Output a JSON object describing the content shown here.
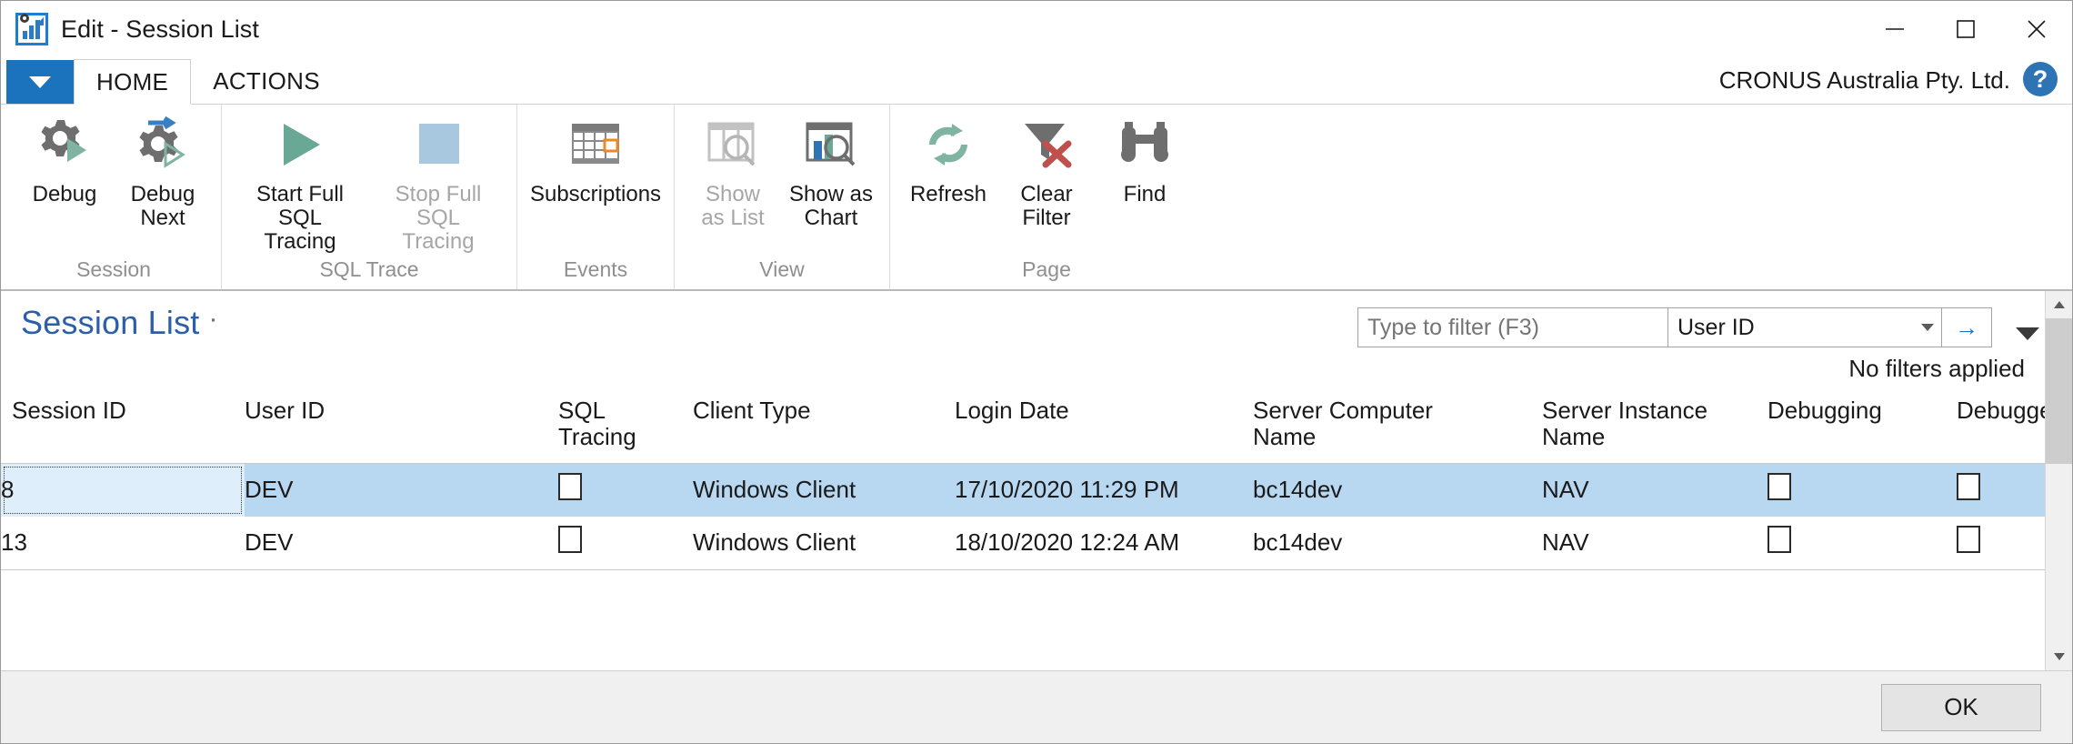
{
  "window": {
    "title": "Edit - Session List",
    "app_icon": "chart-gear-icon",
    "controls": {
      "minimize": "minimize-icon",
      "maximize": "maximize-icon",
      "close": "close-icon"
    }
  },
  "ribbon": {
    "app_menu": "dropdown-caret",
    "tabs": [
      {
        "label": "HOME",
        "active": true
      },
      {
        "label": "ACTIONS",
        "active": false
      }
    ],
    "company": "CRONUS Australia Pty. Ltd.",
    "help": "?",
    "groups": [
      {
        "label": "Session",
        "buttons": [
          {
            "label": "Debug",
            "icon": "gear-play-icon",
            "disabled": false
          },
          {
            "label": "Debug\nNext",
            "line1": "Debug",
            "line2": "Next",
            "icon": "gear-arrow-play-icon",
            "disabled": false
          }
        ]
      },
      {
        "label": "SQL Trace",
        "buttons": [
          {
            "label": "Start Full SQL Tracing",
            "line1": "Start Full SQL",
            "line2": "Tracing",
            "icon": "play-triangle-icon",
            "disabled": false
          },
          {
            "label": "Stop Full SQL Tracing",
            "line1": "Stop Full SQL",
            "line2": "Tracing",
            "icon": "stop-square-icon",
            "disabled": true
          }
        ]
      },
      {
        "label": "Events",
        "buttons": [
          {
            "label": "Subscriptions",
            "line1": "Subscriptions",
            "line2": "",
            "icon": "grid-table-icon",
            "disabled": false
          }
        ]
      },
      {
        "label": "View",
        "buttons": [
          {
            "label": "Show as List",
            "line1": "Show",
            "line2": "as List",
            "icon": "list-search-icon",
            "disabled": true
          },
          {
            "label": "Show as Chart",
            "line1": "Show as",
            "line2": "Chart",
            "icon": "chart-search-icon",
            "disabled": false
          }
        ]
      },
      {
        "label": "Page",
        "buttons": [
          {
            "label": "Refresh",
            "line1": "Refresh",
            "line2": "",
            "icon": "refresh-icon",
            "disabled": false
          },
          {
            "label": "Clear Filter",
            "line1": "Clear",
            "line2": "Filter",
            "icon": "filter-clear-icon",
            "disabled": false
          },
          {
            "label": "Find",
            "line1": "Find",
            "line2": "",
            "icon": "binoculars-icon",
            "disabled": false
          }
        ]
      }
    ]
  },
  "page": {
    "title": "Session List",
    "title_suffix": "·",
    "filter": {
      "placeholder": "Type to filter (F3)",
      "value": "",
      "field": "User ID",
      "go_icon": "arrow-right-icon",
      "dropdown_icon": "chevron-down-icon"
    },
    "collapse_icon": "chevron-down-icon",
    "no_filters_text": "No filters applied"
  },
  "grid": {
    "columns": [
      {
        "key": "session_id",
        "label": "Session ID",
        "line1": "Session ID",
        "line2": "",
        "align": "left"
      },
      {
        "key": "user_id",
        "label": "User ID",
        "line1": "User ID",
        "line2": "",
        "align": "left"
      },
      {
        "key": "sql_tracing",
        "label": "SQL Tracing",
        "line1": "SQL",
        "line2": "Tracing",
        "align": "left"
      },
      {
        "key": "client_type",
        "label": "Client Type",
        "line1": "Client Type",
        "line2": "",
        "align": "left"
      },
      {
        "key": "login_date",
        "label": "Login Date",
        "line1": "Login Date",
        "line2": "",
        "align": "left"
      },
      {
        "key": "server_computer_name",
        "label": "Server Computer Name",
        "line1": "Server Computer",
        "line2": "Name",
        "align": "left"
      },
      {
        "key": "server_instance_name",
        "label": "Server Instance Name",
        "line1": "Server Instance",
        "line2": "Name",
        "align": "left"
      },
      {
        "key": "debugging",
        "label": "Debugging",
        "line1": "Debugging",
        "line2": "",
        "align": "left"
      },
      {
        "key": "debugged",
        "label": "Debugged",
        "line1": "Debugged",
        "line2": "",
        "align": "left"
      }
    ],
    "rows": [
      {
        "selected": true,
        "session_id": "8",
        "user_id": "DEV",
        "sql_tracing": false,
        "client_type": "Windows Client",
        "login_date": "17/10/2020 11:29 PM",
        "server_computer_name": "bc14dev",
        "server_instance_name": "NAV",
        "debugging": false,
        "debugged": false
      },
      {
        "selected": false,
        "session_id": "13",
        "user_id": "DEV",
        "sql_tracing": false,
        "client_type": "Windows Client",
        "login_date": "18/10/2020 12:24 AM",
        "server_computer_name": "bc14dev",
        "server_instance_name": "NAV",
        "debugging": false,
        "debugged": false
      }
    ]
  },
  "footer": {
    "ok_label": "OK"
  },
  "colors": {
    "accent_blue": "#1b72bd",
    "title_blue": "#2b5faa",
    "selection_blue": "#b8d7f0",
    "focus_cell_blue": "#dfeefb",
    "disabled_gray": "#a6a6a6",
    "group_label_gray": "#8f8f8f",
    "green": "#6aa893",
    "orange": "#e8892b",
    "red": "#c0504d"
  }
}
